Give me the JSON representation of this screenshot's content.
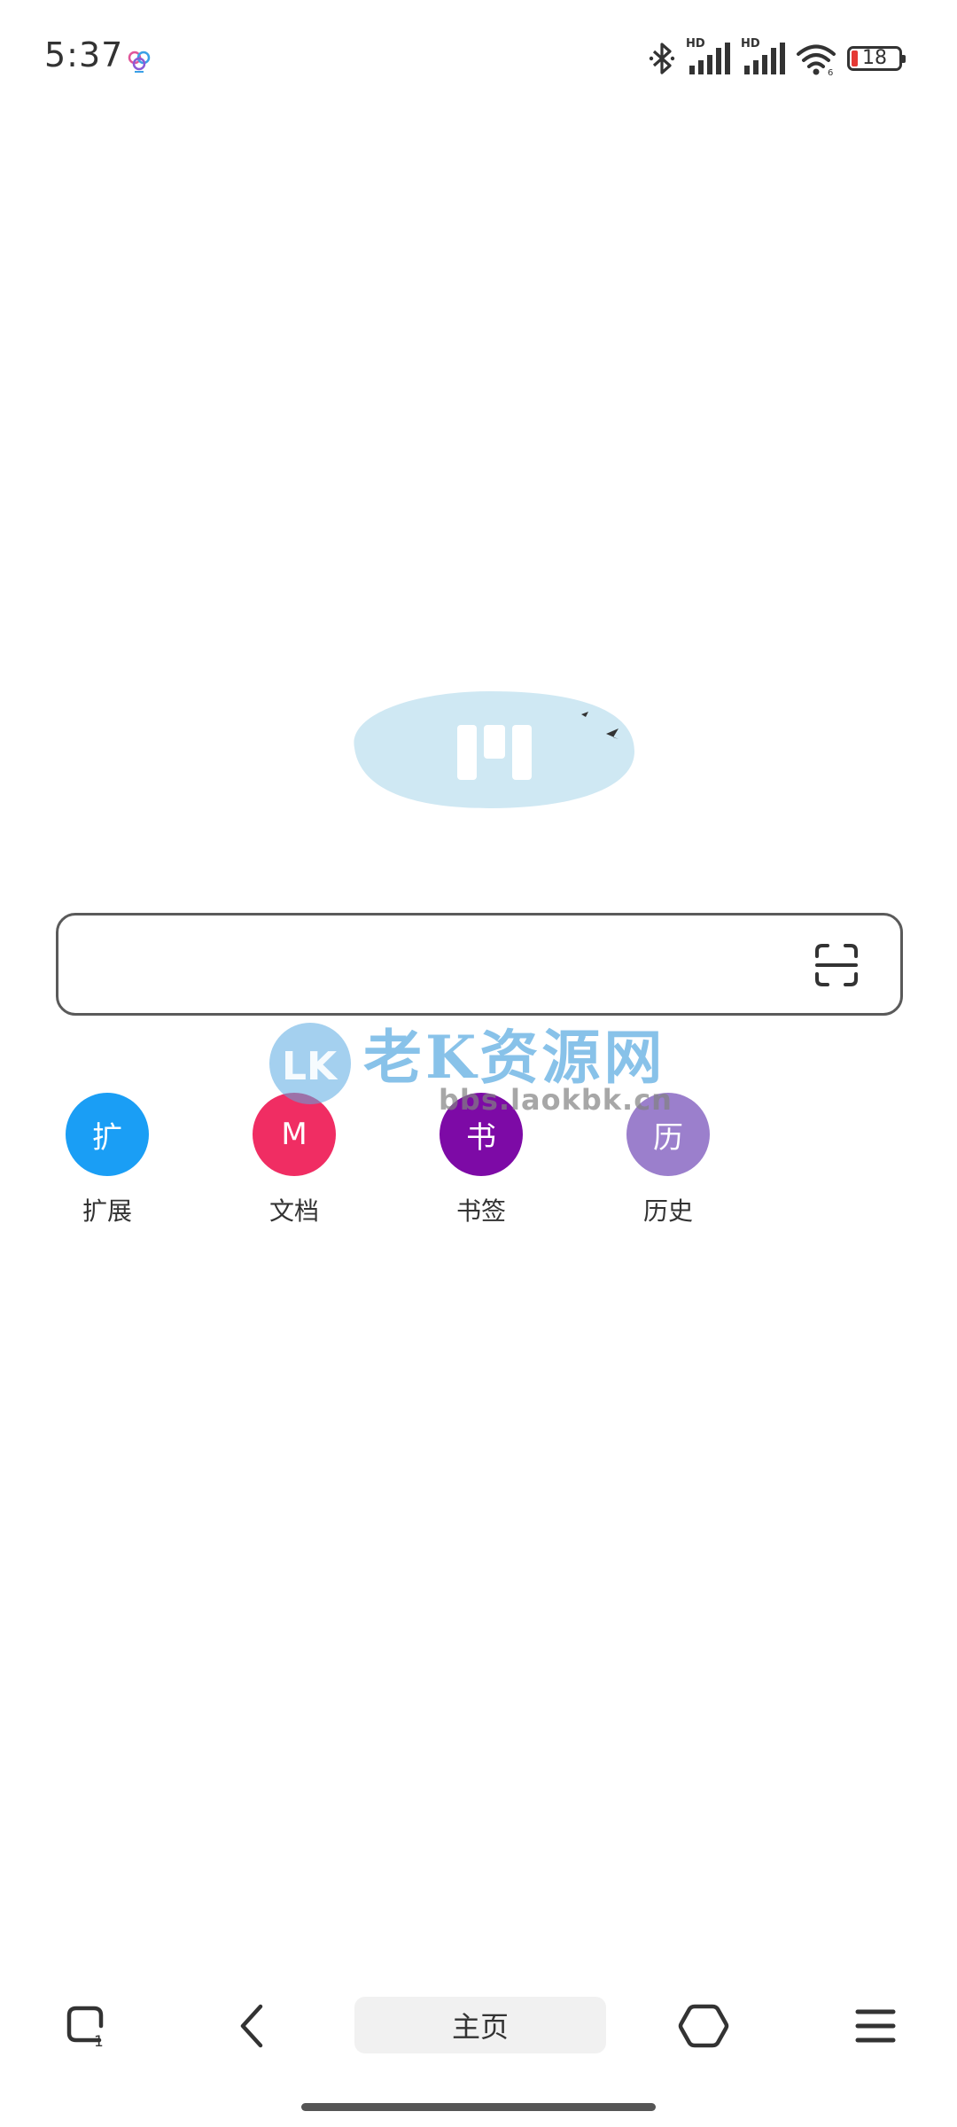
{
  "status_bar": {
    "time": "5:37",
    "hd_label_1": "HD",
    "hd_label_2": "HD",
    "battery_level": "18",
    "icons": [
      "flower-app-icon",
      "bluetooth-icon",
      "cellular-signal-icon",
      "cellular-signal-icon",
      "wifi-icon",
      "battery-icon"
    ]
  },
  "search": {
    "value": "",
    "placeholder": ""
  },
  "shortcuts": [
    {
      "glyph": "扩",
      "label": "扩展",
      "color": "#1a9ef5"
    },
    {
      "glyph": "M",
      "label": "文档",
      "color": "#f02d63"
    },
    {
      "glyph": "书",
      "label": "书签",
      "color": "#7d0aa6"
    },
    {
      "glyph": "历",
      "label": "历史",
      "color": "#9b7fcc"
    }
  ],
  "watermark": {
    "title": "老K资源网",
    "url": "bbs.laokbk.cn"
  },
  "toolbar": {
    "tab_count": "1",
    "home_label": "主页"
  },
  "colors": {
    "logo_blob": "#cfe8f3",
    "battery_low": "#e53935",
    "home_button_bg": "#f1f1f1"
  }
}
